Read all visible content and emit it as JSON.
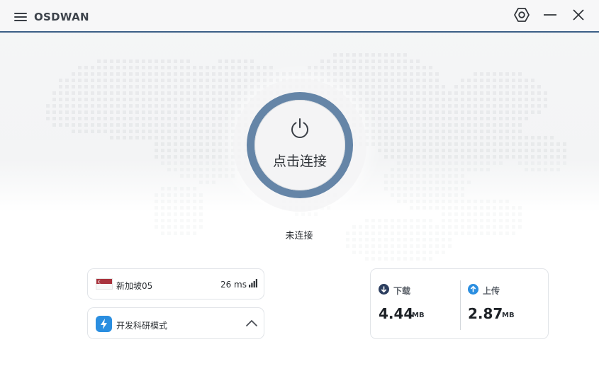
{
  "app": {
    "title": "OSDWAN",
    "icons": {
      "menu": "menu-icon",
      "settings": "hexagon-settings-icon",
      "minimize": "minimize-icon",
      "close": "close-icon"
    }
  },
  "power": {
    "label": "点击连接",
    "icon": "power-icon",
    "colors": {
      "ring": "#6585a7",
      "inner": "#f4f4f5",
      "accent": "#3b5f86"
    }
  },
  "status": {
    "text": "未连接"
  },
  "server": {
    "name": "新加坡05",
    "latency": "26 ms",
    "flag": "singapore-flag",
    "signal_icon": "signal-bars-icon"
  },
  "mode": {
    "label": "开发科研模式",
    "icon": "lightning-icon",
    "chevron": "chevron-up-icon"
  },
  "traffic": {
    "download": {
      "label": "下载",
      "value": "4.44",
      "unit": "MB",
      "icon": "arrow-down-circle-icon",
      "color": "#2c3e5f"
    },
    "upload": {
      "label": "上传",
      "value": "2.87",
      "unit": "MB",
      "icon": "arrow-up-circle-icon",
      "color": "#2a8ee0"
    }
  }
}
